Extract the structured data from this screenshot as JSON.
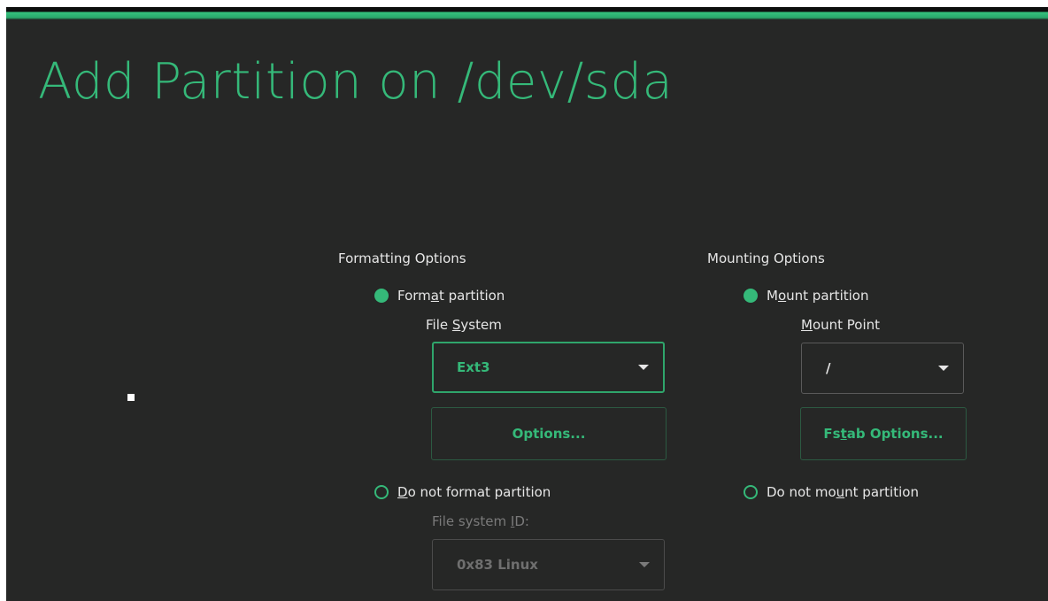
{
  "title": "Add Partition on /dev/sda",
  "formatting": {
    "heading": "Formatting Options",
    "format_radio": {
      "pre": "Form",
      "key": "a",
      "post": "t partition",
      "selected": true
    },
    "fs_label": {
      "pre": "File ",
      "key": "S",
      "post": "ystem"
    },
    "fs_value": "Ext3",
    "options_button": "Options...",
    "noformat_radio": {
      "pre": "",
      "key": "D",
      "post": "o not format partition",
      "selected": false
    },
    "fsid_label": {
      "pre": "File system ",
      "key": "I",
      "post": "D:"
    },
    "fsid_value": "0x83 Linux"
  },
  "mounting": {
    "heading": "Mounting Options",
    "mount_radio": {
      "pre": "M",
      "key": "o",
      "post": "unt partition",
      "selected": true
    },
    "mp_label": {
      "pre": "",
      "key": "M",
      "post": "ount Point"
    },
    "mp_value": "/",
    "fstab_button": {
      "pre": "Fs",
      "key": "t",
      "post": "ab Options..."
    },
    "nomount_radio": {
      "pre": "Do not mo",
      "key": "u",
      "post": "nt partition",
      "selected": false
    }
  },
  "colors": {
    "accent": "#35b979",
    "background": "#262726",
    "text": "#e6e6e6",
    "dim_text": "#7a7a7a"
  }
}
